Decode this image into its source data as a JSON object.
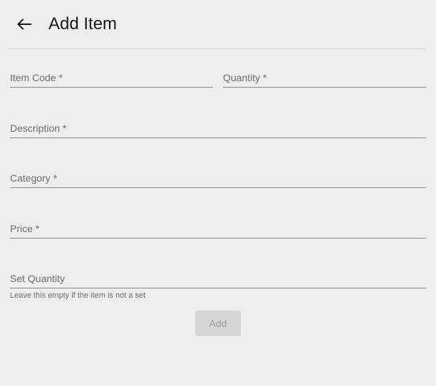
{
  "header": {
    "back_icon": "arrow-left-icon",
    "title": "Add Item"
  },
  "form": {
    "item_code_label": "Item Code *",
    "quantity_label": "Quantity *",
    "description_label": "Description *",
    "category_label": "Category *",
    "price_label": "Price *",
    "set_quantity_label": "Set Quantity",
    "set_quantity_hint": "Leave this empty if the item is not a set",
    "submit_label": "Add"
  },
  "colors": {
    "background": "#eeeeee",
    "disabled_button": "#d6d6d6",
    "label_text": "#6e6e6e"
  }
}
